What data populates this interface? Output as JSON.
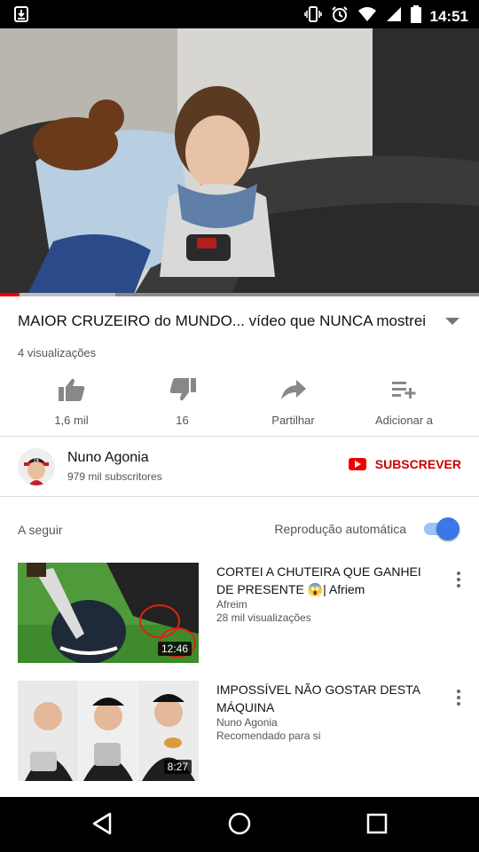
{
  "status_bar": {
    "time": "14:51",
    "icons": [
      "download-notification-icon",
      "vibrate-icon",
      "alarm-icon",
      "wifi-icon",
      "signal-icon",
      "battery-icon"
    ]
  },
  "player": {
    "progress": 0.04,
    "buffered": 0.24,
    "accent_color": "#ee0000"
  },
  "video": {
    "title": "MAIOR CRUZEIRO do MUNDO... vídeo que NUNCA mostrei",
    "views": "4 visualizações"
  },
  "actions": [
    {
      "icon": "thumbs-up-icon",
      "label": "1,6 mil"
    },
    {
      "icon": "thumbs-down-icon",
      "label": "16"
    },
    {
      "icon": "share-icon",
      "label": "Partilhar"
    },
    {
      "icon": "playlist-add-icon",
      "label": "Adicionar a"
    }
  ],
  "channel": {
    "name": "Nuno Agonia",
    "subscribers": "979 mil subscritores",
    "subscribe_label": "SUBSCREVER",
    "avatar_letter": "N"
  },
  "up_next": {
    "label": "A seguir",
    "autoplay_label": "Reprodução automática",
    "autoplay_on": true
  },
  "recommendations": [
    {
      "title": "CORTEI A CHUTEIRA QUE GANHEI DE PRESENTE 😱| Afriem",
      "channel": "Afreim",
      "meta": "28 mil visualizações",
      "duration": "12:46"
    },
    {
      "title": "IMPOSSÍVEL NÃO GOSTAR DESTA MÁQUINA",
      "channel": "Nuno Agonia",
      "meta": "Recomendado para si",
      "duration": "8:27"
    }
  ]
}
